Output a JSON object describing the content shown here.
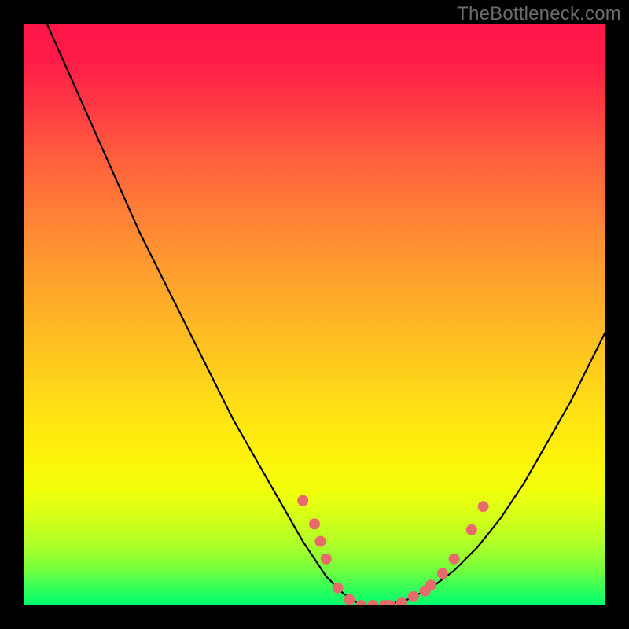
{
  "watermark": "TheBottleneck.com",
  "chart_data": {
    "type": "line",
    "title": "",
    "xlabel": "",
    "ylabel": "",
    "xlim": [
      0,
      100
    ],
    "ylim": [
      0,
      100
    ],
    "series": [
      {
        "name": "bottleneck-curve",
        "x": [
          0,
          4,
          8,
          12,
          16,
          20,
          24,
          28,
          32,
          36,
          40,
          44,
          48,
          52,
          55,
          58,
          62,
          66,
          70,
          74,
          78,
          82,
          86,
          90,
          94,
          98,
          100
        ],
        "values": [
          110,
          100,
          91,
          82,
          73,
          64,
          56,
          48,
          40,
          32,
          25,
          18,
          11,
          5,
          2,
          0,
          0,
          1,
          3,
          6,
          10,
          15,
          21,
          28,
          35,
          43,
          47
        ]
      }
    ],
    "markers": {
      "name": "emphasis-dots",
      "color": "#e86b6b",
      "radius_px": 7,
      "points": [
        {
          "x": 48,
          "y": 18
        },
        {
          "x": 50,
          "y": 14
        },
        {
          "x": 51,
          "y": 11
        },
        {
          "x": 52,
          "y": 8
        },
        {
          "x": 54,
          "y": 3
        },
        {
          "x": 56,
          "y": 1
        },
        {
          "x": 58,
          "y": 0
        },
        {
          "x": 60,
          "y": 0
        },
        {
          "x": 62,
          "y": 0
        },
        {
          "x": 63,
          "y": 0
        },
        {
          "x": 65,
          "y": 0.5
        },
        {
          "x": 67,
          "y": 1.5
        },
        {
          "x": 69,
          "y": 2.5
        },
        {
          "x": 70,
          "y": 3.5
        },
        {
          "x": 72,
          "y": 5.5
        },
        {
          "x": 74,
          "y": 8
        },
        {
          "x": 77,
          "y": 13
        },
        {
          "x": 79,
          "y": 17
        }
      ]
    },
    "colors": {
      "curve": "#000000",
      "marker": "#e86b6b",
      "gradient_top": "#ff1749",
      "gradient_bottom": "#00ff70",
      "frame": "#000000",
      "watermark": "#6c6c6c"
    }
  }
}
